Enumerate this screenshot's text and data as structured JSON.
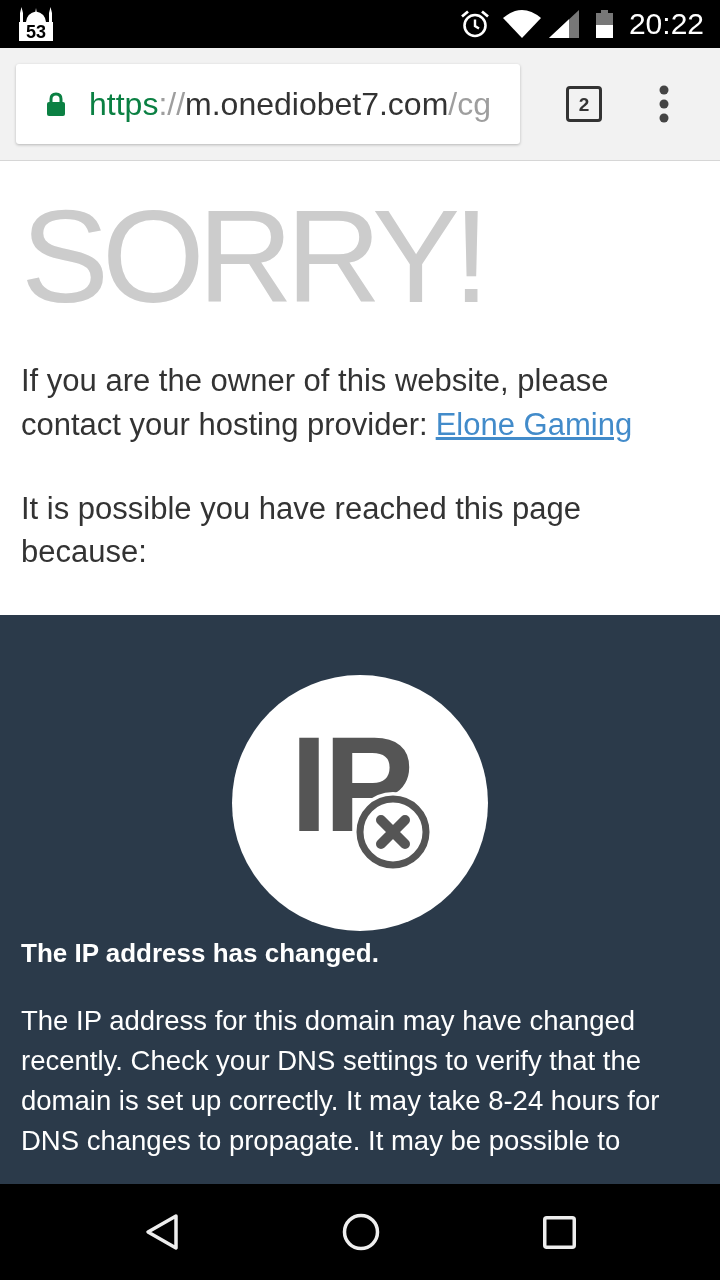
{
  "status_bar": {
    "notification_count": "53",
    "time": "20:22"
  },
  "browser_toolbar": {
    "url": {
      "scheme": "https",
      "separator": "://",
      "host": "m.onediobet7.com",
      "path": "/cg"
    },
    "tab_count": "2"
  },
  "page": {
    "heading": "SORRY!",
    "owner_note": {
      "text": "If you are the owner of this website, please contact your hosting provider:",
      "link": "Elone Gaming"
    },
    "reason_intro": "It is possible you have reached this page because:"
  },
  "reasons": [
    {
      "kind": "ip",
      "icon_label": "IP",
      "title": "The IP address has changed.",
      "text": "The IP address for this domain may have changed recently. Check your DNS settings to verify that the domain is set up correctly. It may take 8-24 hours for DNS changes to propagate. It may be possible to"
    }
  ]
}
